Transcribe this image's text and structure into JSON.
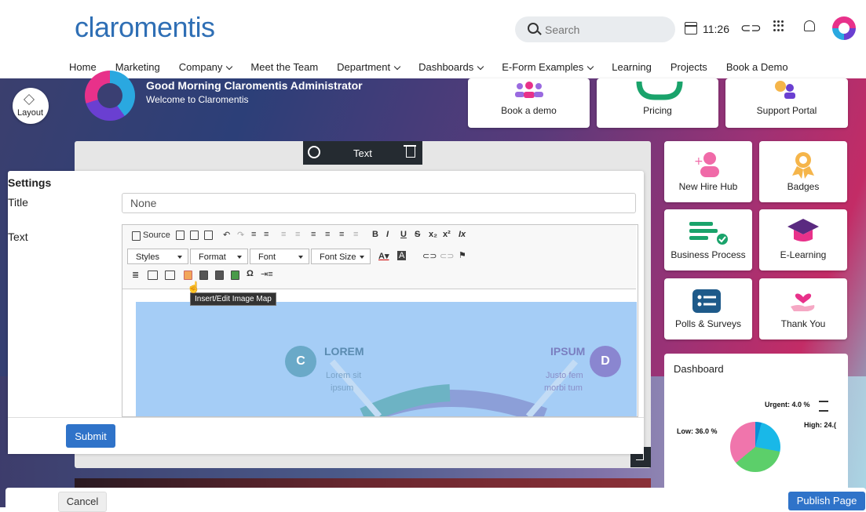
{
  "header": {
    "logo_text": "claromentis",
    "search_placeholder": "Search",
    "time": "11:26",
    "nav": [
      "Home",
      "Marketing",
      "Company",
      "Meet the Team",
      "Department",
      "Dashboards",
      "E-Form Examples",
      "Learning",
      "Projects",
      "Book a Demo"
    ],
    "nav_has_dropdown": [
      false,
      false,
      true,
      false,
      true,
      true,
      true,
      false,
      false,
      false
    ]
  },
  "hero": {
    "greeting": "Good Morning Claromentis Administrator",
    "welcome": "Welcome to Claromentis",
    "layout_label": "Layout"
  },
  "tiles": {
    "book_demo": "Book a demo",
    "pricing": "Pricing",
    "support": "Support Portal",
    "new_hire": "New Hire Hub",
    "badges": "Badges",
    "business_process": "Business Process",
    "e_learning": "E-Learning",
    "polls": "Polls & Surveys",
    "thank_you": "Thank You"
  },
  "dashboard": {
    "title": "Dashboard",
    "labels": {
      "urgent": "Urgent: 4.0 %",
      "high": "High: 24.(",
      "low": "Low: 36.0 %"
    }
  },
  "widget_toolbar": {
    "label": "Text"
  },
  "settings": {
    "title": "Settings",
    "title_label": "Title",
    "title_value": "None",
    "text_label": "Text",
    "editor": {
      "source": "Source",
      "styles": "Styles",
      "format": "Format",
      "font": "Font",
      "font_size": "Font Size",
      "tooltip": "Insert/Edit Image Map"
    },
    "infographic": {
      "left_letter": "C",
      "left_title": "LOREM",
      "left_sub1": "Lorem sit",
      "left_sub2": "ipsum",
      "right_letter": "D",
      "right_title": "IPSUM",
      "right_sub1": "Justo fem",
      "right_sub2": "morbi tum"
    },
    "submit": "Submit"
  },
  "footer": {
    "cancel": "Cancel",
    "publish": "Publish Page"
  },
  "colors": {
    "brand": "#2f6fb5",
    "primary_button": "#2f73c9",
    "toolbar_dark": "#252b31"
  }
}
